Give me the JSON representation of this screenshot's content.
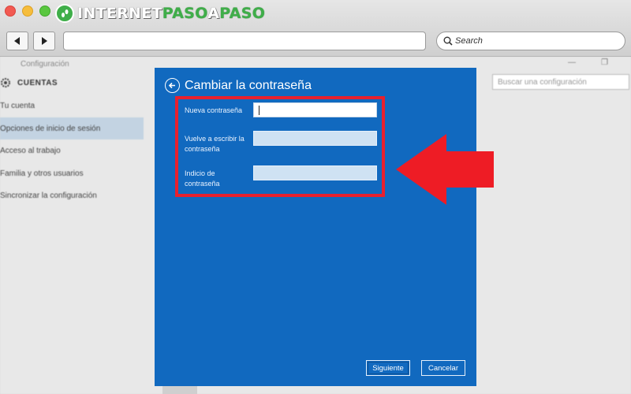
{
  "browser": {
    "brand_prefix": "INTERNET",
    "brand_accent": "PASO",
    "brand_mid": "A",
    "brand_suffix": "PASO",
    "search_label": "Search",
    "back_icon": "arrow-left-icon",
    "forward_icon": "arrow-right-icon",
    "colors": {
      "brand_green": "#3fae49"
    }
  },
  "settings": {
    "window_title": "Configuración",
    "section": "CUENTAS",
    "search_placeholder": "Buscar una configuración",
    "sidebar": [
      {
        "label": "Tu cuenta",
        "active": false
      },
      {
        "label": "Opciones de inicio de sesión",
        "active": true
      },
      {
        "label": "Acceso al trabajo",
        "active": false
      },
      {
        "label": "Familia y otros usuarios",
        "active": false
      },
      {
        "label": "Sincronizar la configuración",
        "active": false
      }
    ]
  },
  "dialog": {
    "title": "Cambiar la contraseña",
    "fields": [
      {
        "label": "Nueva contraseña",
        "value": ""
      },
      {
        "label": "Vuelve a escribir la contraseña",
        "value": ""
      },
      {
        "label": "Indicio de contraseña",
        "value": ""
      }
    ],
    "next_button": "Siguiente",
    "cancel_button": "Cancelar",
    "colors": {
      "background": "#1169bf",
      "highlight": "#e8202e"
    }
  }
}
